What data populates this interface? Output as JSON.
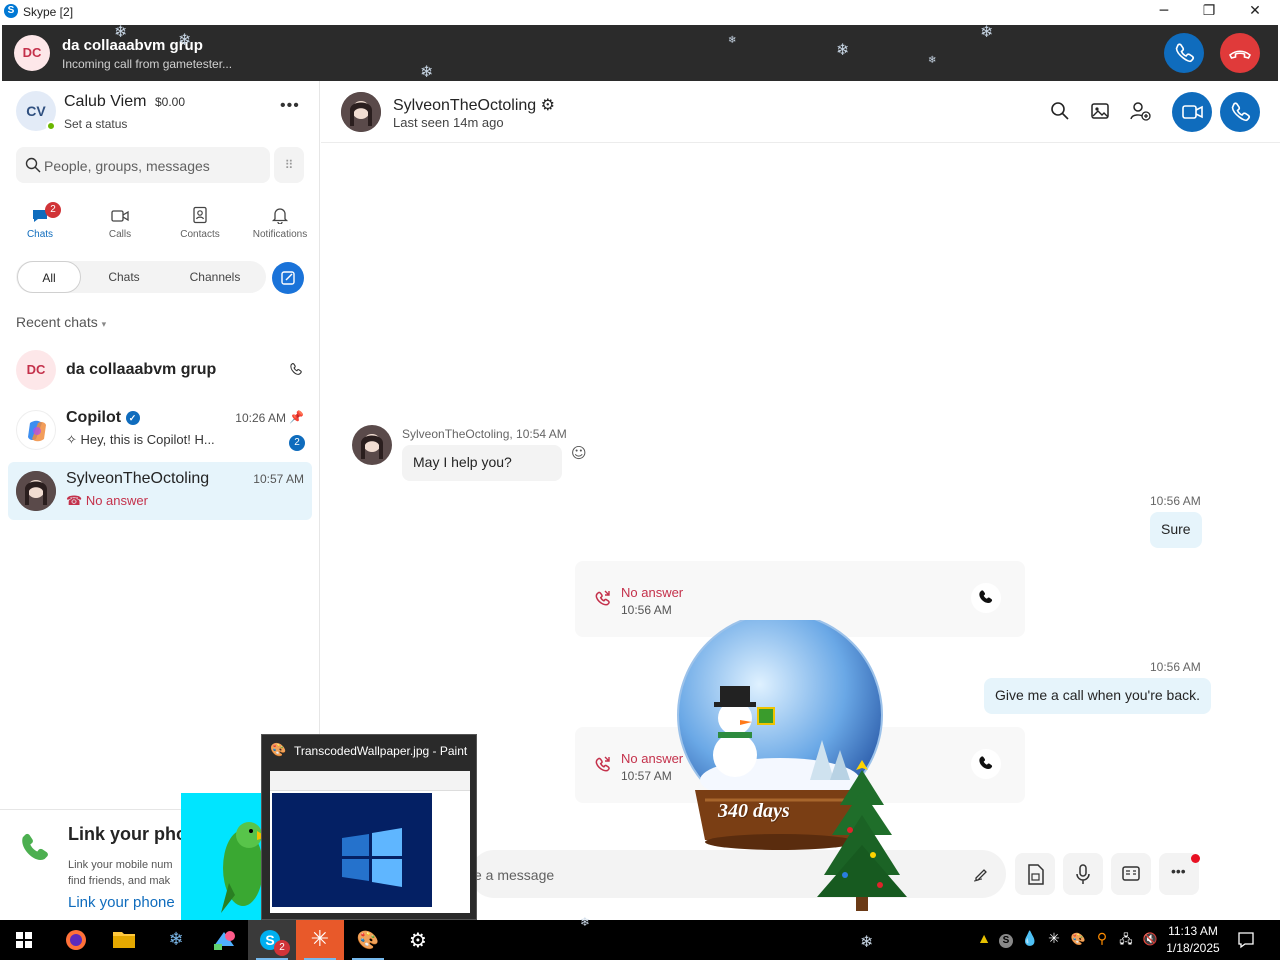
{
  "window": {
    "icon_letter": "S",
    "title": "Skype [2]",
    "minimize": "─",
    "restore": "❐",
    "close": "✕"
  },
  "incoming_call": {
    "avatar_initials": "DC",
    "group_name": "da collaaabvm grup",
    "subtitle": "Incoming call from gametester...",
    "accept_icon": "phone-icon",
    "decline_icon": "hang-up-icon"
  },
  "profile": {
    "initials": "CV",
    "name": "Calub Viem",
    "credit": "$0.00",
    "status": "Set a status",
    "more": "•••"
  },
  "search": {
    "placeholder": "People, groups, messages"
  },
  "nav_tabs": [
    {
      "label": "Chats",
      "badge": "2",
      "icon": "chat-icon"
    },
    {
      "label": "Calls",
      "icon": "video-icon"
    },
    {
      "label": "Contacts",
      "icon": "contacts-icon"
    },
    {
      "label": "Notifications",
      "icon": "bell-icon"
    }
  ],
  "filters": {
    "all": "All",
    "chats": "Chats",
    "channels": "Channels"
  },
  "recent_label": "Recent chats",
  "chats": [
    {
      "initials": "DC",
      "name": "da collaaabvm grup",
      "time": "",
      "preview": "",
      "icon": "phone-icon"
    },
    {
      "name": "Copilot",
      "time": "10:26 AM",
      "preview": "Hey, this is Copilot! H...",
      "badge": "2",
      "icon": "pin-icon"
    },
    {
      "name": "SylveonTheOctoling",
      "time": "10:57 AM",
      "preview": "No answer"
    }
  ],
  "promo": {
    "title": "Link your pho",
    "body": "Link your mobile num find friends, and mak",
    "link": "Link your phone"
  },
  "conversation": {
    "contact_name": "SylveonTheOctoling",
    "last_seen": "Last seen 14m ago",
    "messages": {
      "in_meta": "SylveonTheOctoling, 10:54 AM",
      "in_text": "May I help you?",
      "out1_time": "10:56 AM",
      "out1_text": "Sure",
      "call1_status": "No answer",
      "call1_time": "10:56 AM",
      "out2_time": "10:56 AM",
      "out2_text": "Give me a call when you're back.",
      "call2_status": "No answer",
      "call2_time": "10:57 AM"
    },
    "composer_placeholder": "e a message"
  },
  "snowglobe": {
    "counter": "340 days"
  },
  "thumbnail": {
    "title": "TranscodedWallpaper.jpg - Paint"
  },
  "taskbar": {
    "time": "11:13 AM",
    "date": "1/18/2025",
    "skype_badge": "2"
  },
  "colors": {
    "accent": "#0f6cbd",
    "decline": "#e03a3a",
    "callbar": "#2b2b2b",
    "missed": "#c4314b",
    "selected_chat": "#e6f4fb"
  }
}
